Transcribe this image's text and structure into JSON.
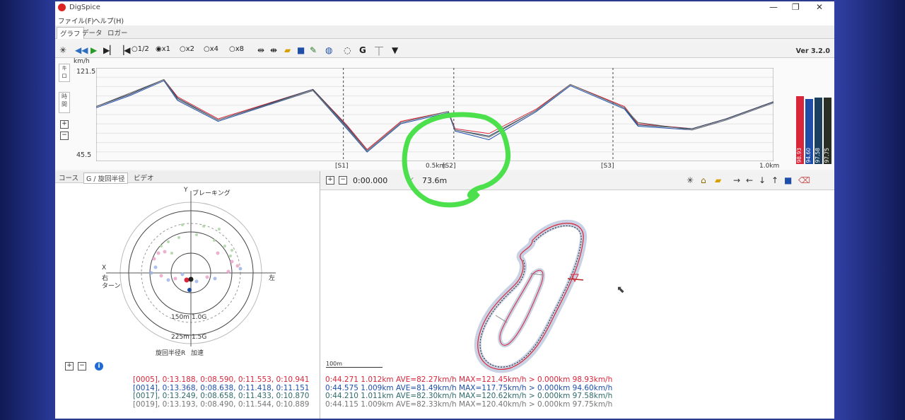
{
  "window": {
    "title": "DigSpice",
    "minimize": "—",
    "maximize": "❐",
    "close": "✕"
  },
  "menu": [
    "ファイル(F)",
    "ヘルプ(H)"
  ],
  "tabs": [
    "グラフ",
    "データ",
    "ロガー"
  ],
  "toolbar": {
    "speed_options": [
      "1/2",
      "x1",
      "x2",
      "x4",
      "x8"
    ],
    "selected_speed": "x1",
    "g_label": "G",
    "version": "Ver 3.2.0"
  },
  "speed_chart": {
    "unit": "km/h",
    "side_tabs": [
      "キロ",
      "時間"
    ],
    "y_max_label": "121.5",
    "y_min_label": "45.5",
    "sector_labels": [
      "[S1]",
      "0.5km",
      "[S2]",
      "[S3]",
      "1.0km"
    ],
    "bars": [
      {
        "value": "98.93",
        "color": "#d9263a"
      },
      {
        "value": "94.60",
        "color": "#1e4ea8"
      },
      {
        "value": "97.58",
        "color": "#1b3f5e"
      },
      {
        "value": "97.75",
        "color": "#2a2f25"
      }
    ]
  },
  "chart_data": {
    "type": "line",
    "xlabel": "",
    "ylabel": "km/h",
    "ylim": [
      45.5,
      121.5
    ],
    "x": [
      0,
      0.05,
      0.1,
      0.12,
      0.18,
      0.32,
      0.37,
      0.4,
      0.45,
      0.52,
      0.53,
      0.58,
      0.65,
      0.7,
      0.78,
      0.8,
      0.88,
      0.93,
      1.0
    ],
    "series": [
      {
        "color": "#d9263a",
        "values": [
          90,
          100,
          112,
          98,
          80,
          104,
          75,
          55,
          78,
          86,
          72,
          68,
          88,
          108,
          90,
          76,
          72,
          80,
          94
        ]
      },
      {
        "color": "#1e4ea8",
        "values": [
          89,
          99,
          111,
          95,
          78,
          103,
          72,
          53,
          76,
          85,
          70,
          63,
          86,
          107,
          88,
          74,
          71,
          79,
          93
        ]
      },
      {
        "color": "#1b3f5e",
        "values": [
          90,
          100,
          112,
          97,
          79,
          104,
          74,
          54,
          77,
          86,
          71,
          66,
          87,
          108,
          89,
          75,
          72,
          80,
          94
        ]
      },
      {
        "color": "#6b6b6b",
        "values": [
          90,
          101,
          112,
          96,
          79,
          103,
          73,
          54,
          77,
          86,
          71,
          65,
          87,
          108,
          89,
          77,
          71,
          79,
          93
        ]
      }
    ]
  },
  "g_panel": {
    "tabs": [
      "コース",
      "G / 旋回半径",
      "ビデオ"
    ],
    "y_label": "Y",
    "braking": "ブレーキング",
    "x_label": "X",
    "right_turn": [
      "右",
      "ターン"
    ],
    "left": "左",
    "ring1": "150m",
    "ring1g": "1.0G",
    "ring2": "225m",
    "ring2g": "1.5G",
    "radius_label": "旋回半径R",
    "accel_label": "加速"
  },
  "track": {
    "time": "0:00.000",
    "distance": "73.6m",
    "scale": "100m"
  },
  "laps_left": [
    {
      "text": "[0005], 0:13.188, 0:08.590, 0:11.553, 0:10.941",
      "color": "#d9263a"
    },
    {
      "text": "[0014], 0:13.368, 0:08.638, 0:11.418, 0:11.151",
      "color": "#1e4ea8"
    },
    {
      "text": "[0017], 0:13.249, 0:08.658, 0:11.433, 0:10.870",
      "color": "#2f6a6a"
    },
    {
      "text": "[0019], 0:13.193, 0:08.490, 0:11.544, 0:10.889",
      "color": "#777777"
    }
  ],
  "laps_right": [
    {
      "text": "0:44.271 1.012km AVE=82.27km/h MAX=121.45km/h > 0.000km 98.93km/h",
      "color": "#d9263a"
    },
    {
      "text": "0:44.575 1.009km AVE=81.49km/h MAX=117.75km/h > 0.000km 94.60km/h",
      "color": "#1e4ea8"
    },
    {
      "text": "0:44.210 1.011km AVE=82.30km/h MAX=120.62km/h > 0.000km 97.58km/h",
      "color": "#2f6a6a"
    },
    {
      "text": "0:44.115 1.009km AVE=82.33km/h MAX=120.40km/h > 0.000km 97.75km/h",
      "color": "#777777"
    }
  ]
}
